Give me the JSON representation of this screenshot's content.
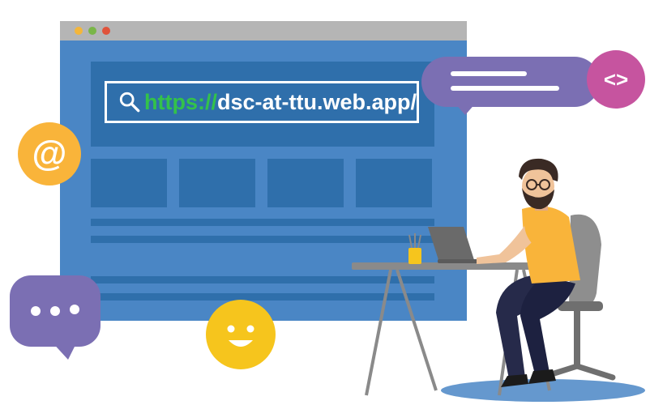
{
  "browser": {
    "url_scheme": "https://",
    "url_host": "dsc-at-ttu.web.app/",
    "window_dots": [
      "#f4b63a",
      "#7ab648",
      "#e0533b"
    ]
  },
  "badges": {
    "code_label": "<>",
    "at_label": "@"
  },
  "colors": {
    "browser_body": "#4a86c5",
    "browser_blocks": "#2f6fab",
    "url_scheme": "#33c24a",
    "purple": "#7b6fb3",
    "pink": "#c6549f",
    "orange": "#f9b43a",
    "yellow": "#f6c51d"
  }
}
